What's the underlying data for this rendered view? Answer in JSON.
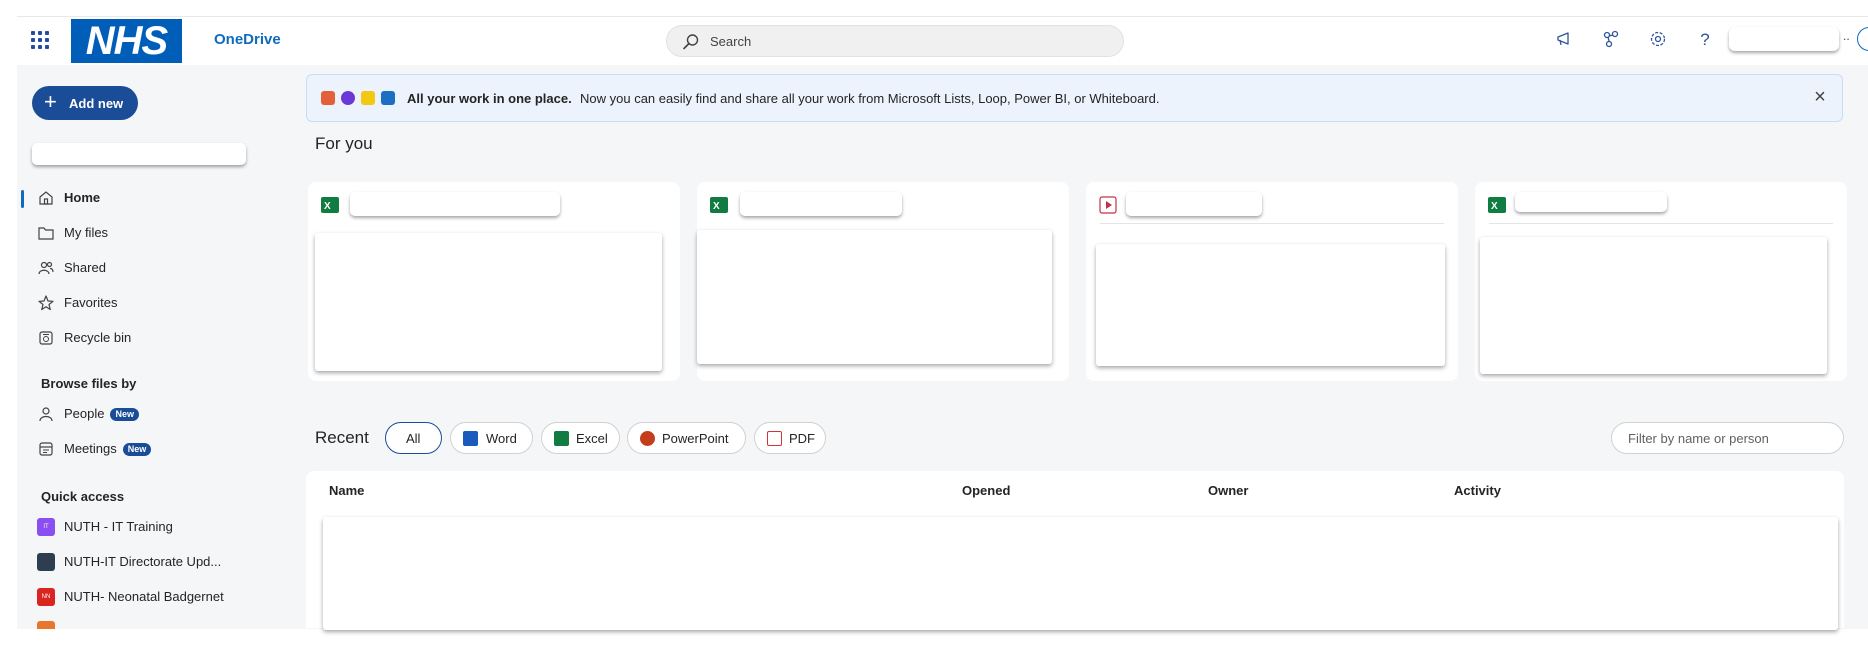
{
  "header": {
    "logo_text": "NHS",
    "app_name": "OneDrive",
    "search_placeholder": "Search",
    "account_ellipsis": "..",
    "icons": [
      "waffle-icon",
      "megaphone-icon",
      "share-icon",
      "settings-icon",
      "help-icon"
    ]
  },
  "sidebar": {
    "add_new_label": "Add new",
    "nav": [
      {
        "label": "Home",
        "icon": "home-icon",
        "active": true
      },
      {
        "label": "My files",
        "icon": "folder-icon"
      },
      {
        "label": "Shared",
        "icon": "people-icon"
      },
      {
        "label": "Favorites",
        "icon": "star-icon"
      },
      {
        "label": "Recycle bin",
        "icon": "recycle-bin-icon"
      }
    ],
    "browse_heading": "Browse files by",
    "browse": [
      {
        "label": "People",
        "badge": "New",
        "icon": "person-icon"
      },
      {
        "label": "Meetings",
        "badge": "New",
        "icon": "calendar-icon"
      }
    ],
    "quick_access_heading": "Quick access",
    "quick_access": [
      {
        "label": "NUTH - IT Training",
        "color": "#8a4ff0"
      },
      {
        "label": "NUTH-IT Directorate Upd...",
        "color": "#2d3e50"
      },
      {
        "label": "NUTH- Neonatal Badgernet",
        "color": "#d9241f"
      }
    ]
  },
  "banner": {
    "title": "All your work in one place.",
    "text": "Now you can easily find and share all your work from Microsoft Lists, Loop, Power BI, or Whiteboard."
  },
  "for_you": {
    "heading": "For you",
    "cards": [
      {
        "file_type": "excel"
      },
      {
        "file_type": "excel"
      },
      {
        "file_type": "video"
      },
      {
        "file_type": "excel"
      }
    ]
  },
  "recent": {
    "heading": "Recent",
    "filters": [
      {
        "label": "All",
        "selected": true
      },
      {
        "label": "Word",
        "icon": "word-icon"
      },
      {
        "label": "Excel",
        "icon": "excel-icon"
      },
      {
        "label": "PowerPoint",
        "icon": "powerpoint-icon"
      },
      {
        "label": "PDF",
        "icon": "pdf-icon"
      }
    ],
    "filter_placeholder": "Filter by name or person",
    "columns": [
      "Name",
      "Opened",
      "Owner",
      "Activity"
    ]
  },
  "colors": {
    "accent": "#0f6cbd",
    "button": "#1a4c97",
    "nhs_blue": "#005eb8",
    "excel": "#107c41",
    "word": "#185abd",
    "powerpoint": "#c43e1c",
    "pdf": "#d13438"
  }
}
